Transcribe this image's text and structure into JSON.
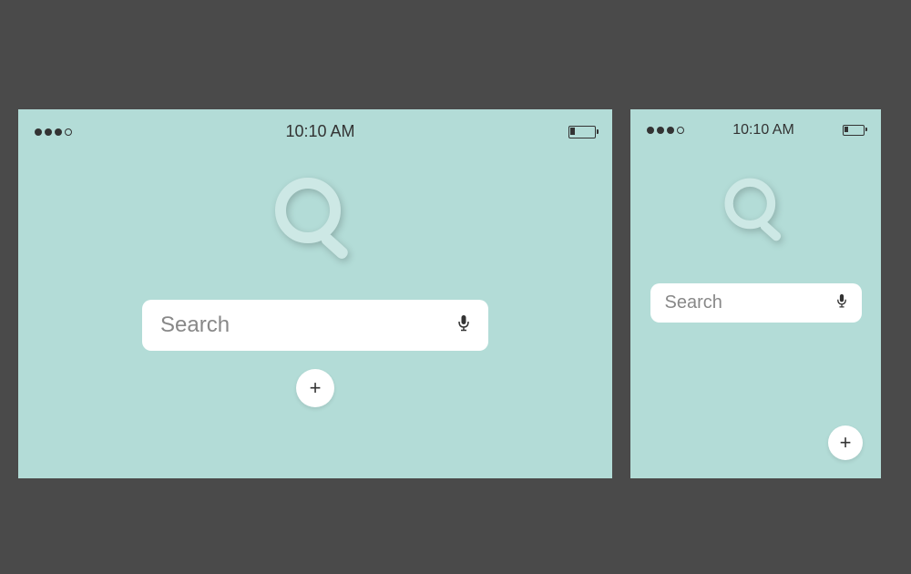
{
  "tablet": {
    "status": {
      "time": "10:10 AM"
    },
    "search": {
      "placeholder": "Search"
    },
    "add_button": {
      "symbol": "+"
    }
  },
  "phone": {
    "status": {
      "time": "10:10 AM"
    },
    "search": {
      "placeholder": "Search"
    },
    "add_button": {
      "symbol": "+"
    }
  },
  "colors": {
    "background": "#4a4a4a",
    "device_bg": "#b3dcd7",
    "search_bg": "#ffffff",
    "text_dark": "#333333",
    "placeholder": "#888888"
  }
}
